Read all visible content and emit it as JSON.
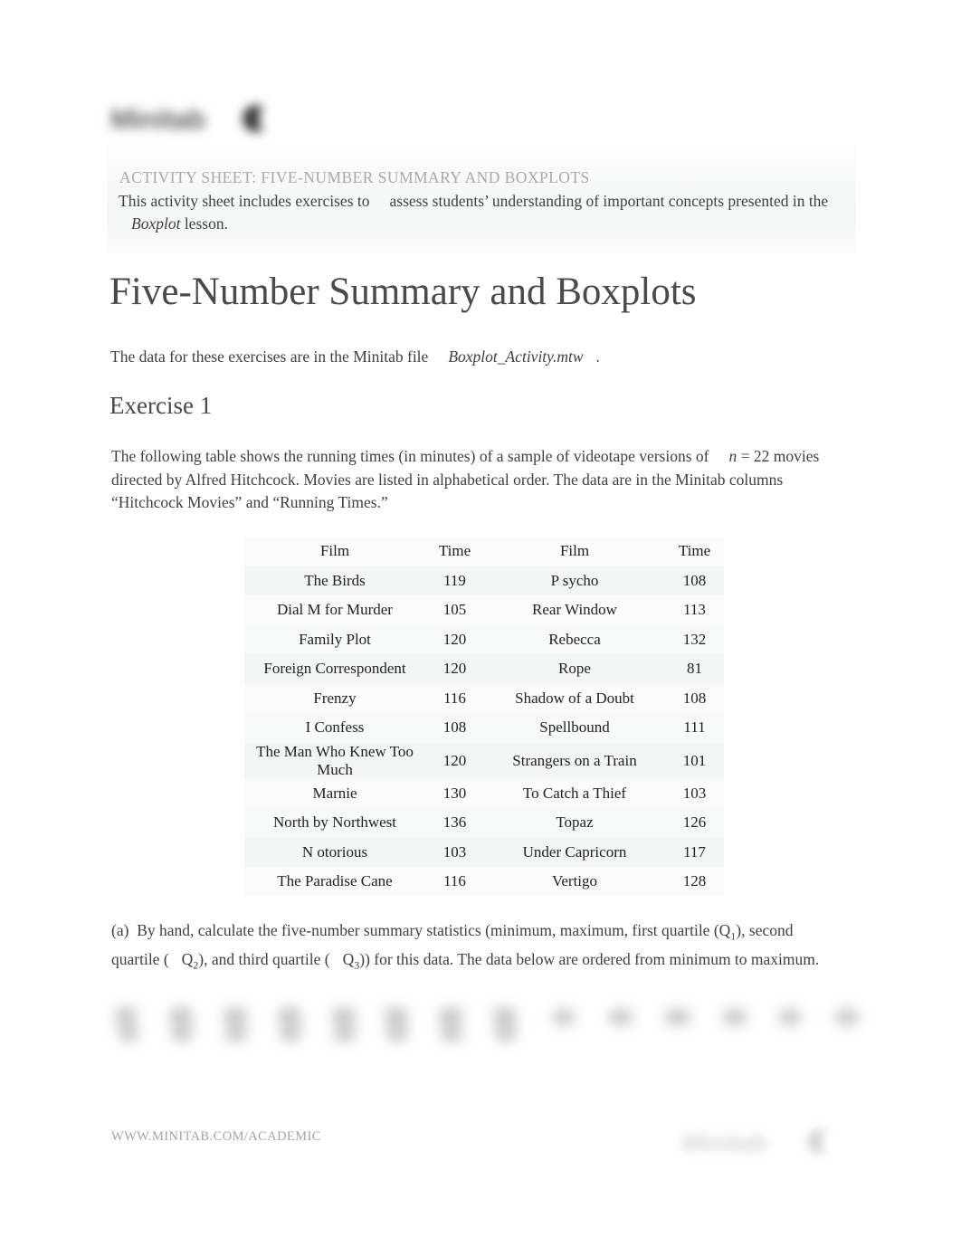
{
  "brand": {
    "logo_wordmark": "Minitab",
    "logo_icon": "minitab-circle-mark",
    "footer_logo_wordmark": "Minitab"
  },
  "header": {
    "kicker": "ACTIVITY SHEET: FIVE-NUMBER SUMMARY AND BOXPLOTS",
    "subhead_part1": "This activity sheet includes exercises to",
    "subhead_part2": "assess students’ understanding of important concepts presented in the",
    "subhead_emphasis": "Boxplot",
    "subhead_part3": "lesson."
  },
  "title": "Five-Number Summary and Boxplots",
  "intro": {
    "text_before": "The data for these exercises are in the Minitab file",
    "file_name": "Boxplot_Activity.mtw",
    "text_after": "."
  },
  "exercise": {
    "heading": "Exercise 1",
    "paragraph_part1": "The following table shows the running times (in minutes) of a sample of videotape versions of",
    "paragraph_n": "n",
    "paragraph_part2": "= 22 movies directed by Alfred Hitchcock. Movies are listed in alphabetical order. The data are in the Minitab columns “Hitchcock Movies” and “Running Times.”"
  },
  "table": {
    "headers": [
      "Film",
      "Time",
      "Film",
      "Time"
    ],
    "rows": [
      [
        "The  Birds",
        "119",
        "P sycho",
        "108"
      ],
      [
        "Dial M for Murder",
        "105",
        "Rear Window",
        "113"
      ],
      [
        "Family Plot",
        "120",
        "Rebecca",
        "132"
      ],
      [
        "Foreign Correspondent",
        "120",
        "Rope",
        "81"
      ],
      [
        "Frenzy",
        "116",
        "Shadow of a Doubt",
        "108"
      ],
      [
        "I Confess",
        "108",
        "Spellbound",
        "111"
      ],
      [
        "The  Man Who Knew Too Much",
        "120",
        "Strangers on a Train",
        "101"
      ],
      [
        "Marnie",
        "130",
        "To Catch a Thief",
        "103"
      ],
      [
        "North by Northwest",
        "136",
        "Topaz",
        "126"
      ],
      [
        "N otorious",
        "103",
        "Under Capricorn",
        "117"
      ],
      [
        "The  Paradise Cane",
        "116",
        "Vertigo",
        "128"
      ]
    ]
  },
  "part_a": {
    "label": "(a)",
    "text_1": "By hand, calculate the five-number summary statistics (minimum, maximum, first quartile (Q",
    "sub_1": "1",
    "text_2": "), second quartile (",
    "q2": "Q",
    "sub_2": "2",
    "text_3": "), and third quartile (",
    "q3": "Q",
    "sub_3": "3",
    "text_4": ")) for this data. The data below are ordered from minimum to maximum."
  },
  "redacted_values_row": {
    "description": "blurred-unreadable-ordered-data-values",
    "item_count": 14
  },
  "footer": {
    "url": "WWW.MINITAB.COM/ACADEMIC"
  },
  "colors": {
    "body_text": "#3f3f3f",
    "heading_text": "#4a4a4a",
    "kicker_text": "#a9a9a9",
    "footer_text": "#a5a5a5",
    "table_band_light": "#fbfbfb",
    "table_band_dark": "#f4f5f5",
    "page_background": "#ffffff"
  }
}
